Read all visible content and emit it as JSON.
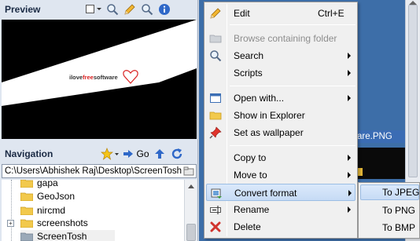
{
  "preview": {
    "title": "Preview",
    "image_text_a": "ilove",
    "image_text_b": "free",
    "image_text_c": "software"
  },
  "navigation": {
    "title": "Navigation",
    "go_label": "Go",
    "path": "C:\\Users\\Abhishek Raj\\Desktop\\ScreenTosh",
    "tree": [
      "gapa",
      "GeoJson",
      "nircmd",
      "screenshots",
      "ScreenTosh"
    ]
  },
  "right": {
    "selected_file": "are.PNG"
  },
  "context_menu": {
    "items": [
      {
        "label": "Edit",
        "shortcut": "Ctrl+E",
        "icon": "pencil-icon"
      },
      {
        "label": "Browse containing folder",
        "icon": "folder-icon",
        "disabled": true
      },
      {
        "label": "Search",
        "icon": "magnifier-icon"
      },
      {
        "label": "Scripts",
        "icon": "none"
      },
      {
        "label": "Open with...",
        "icon": "window-icon"
      },
      {
        "label": "Show in Explorer",
        "icon": "folder-icon"
      },
      {
        "label": "Set as wallpaper",
        "icon": "pin-icon"
      },
      {
        "label": "Copy to",
        "icon": "none"
      },
      {
        "label": "Move to",
        "icon": "none"
      },
      {
        "label": "Convert format",
        "icon": "convert-icon"
      },
      {
        "label": "Rename",
        "icon": "rename-icon"
      },
      {
        "label": "Delete",
        "icon": "delete-x-icon"
      }
    ]
  },
  "convert_submenu": {
    "items": [
      "To JPEG",
      "To PNG",
      "To BMP"
    ]
  },
  "colors": {
    "accent": "#3d6ea8",
    "hover": "#c6dbf5",
    "delete": "#d1342e"
  }
}
